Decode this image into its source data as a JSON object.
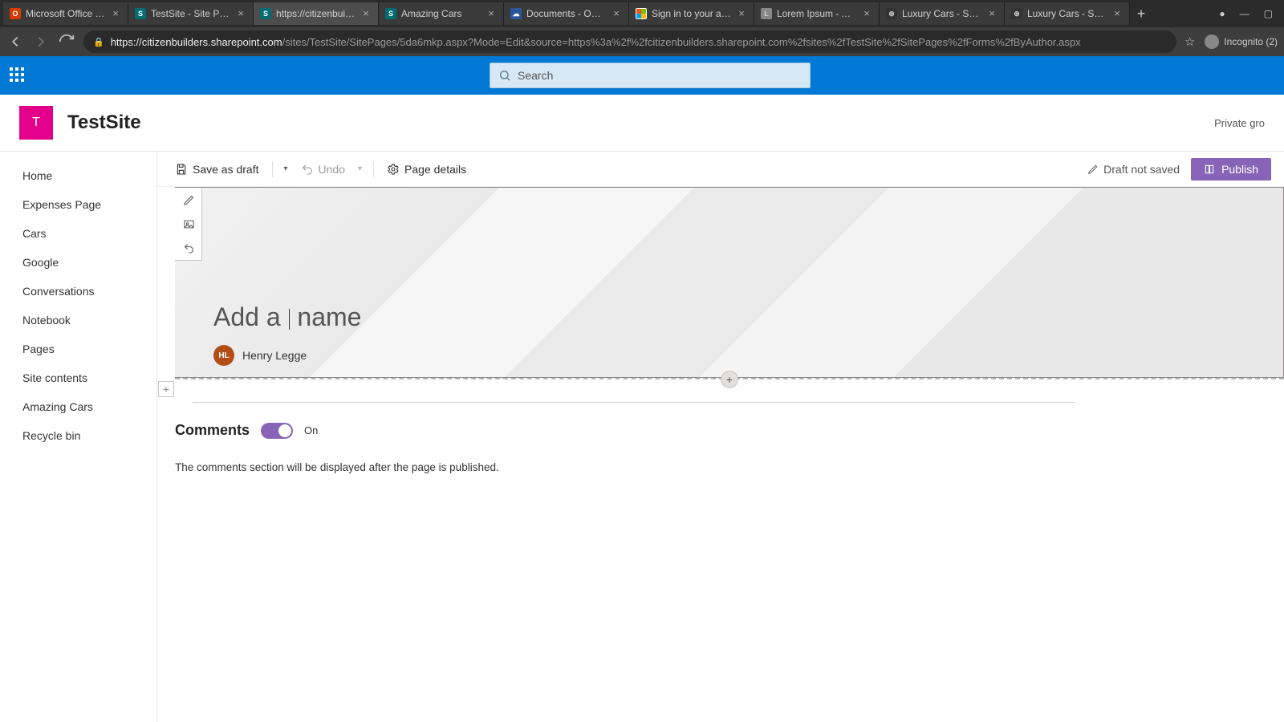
{
  "browser": {
    "tabs": [
      {
        "title": "Microsoft Office Home",
        "favicon": "fav-red",
        "letter": "O"
      },
      {
        "title": "TestSite - Site Pages -",
        "favicon": "fav-teal",
        "letter": "S"
      },
      {
        "title": "https://citizenbuilders",
        "favicon": "fav-teal",
        "letter": "S",
        "active": true
      },
      {
        "title": "Amazing Cars",
        "favicon": "fav-teal",
        "letter": "S"
      },
      {
        "title": "Documents - OneDriv",
        "favicon": "fav-blue",
        "letter": "☁"
      },
      {
        "title": "Sign in to your accoun",
        "favicon": "fav-ms",
        "letter": ""
      },
      {
        "title": "Lorem Ipsum - All the",
        "favicon": "fav-grey",
        "letter": "L"
      },
      {
        "title": "Luxury Cars - Sedans,",
        "favicon": "fav-dark",
        "letter": "⊕"
      },
      {
        "title": "Luxury Cars - Sedans,",
        "favicon": "fav-dark",
        "letter": "⊕"
      }
    ],
    "url_host": "https://citizenbuilders.sharepoint.com",
    "url_path": "/sites/TestSite/SitePages/5da6mkp.aspx?Mode=Edit&source=https%3a%2f%2fcitizenbuilders.sharepoint.com%2fsites%2fTestSite%2fSitePages%2fForms%2fByAuthor.aspx",
    "incognito_label": "Incognito (2)"
  },
  "suite": {
    "search_placeholder": "Search"
  },
  "site": {
    "logo_letter": "T",
    "title": "TestSite",
    "meta": "Private gro"
  },
  "nav": {
    "items": [
      "Home",
      "Expenses Page",
      "Cars",
      "Google",
      "Conversations",
      "Notebook",
      "Pages",
      "Site contents",
      "Amazing Cars",
      "Recycle bin"
    ]
  },
  "cmd": {
    "save": "Save as draft",
    "undo": "Undo",
    "page_details": "Page details",
    "draft_status": "Draft not saved",
    "publish": "Publish"
  },
  "hero": {
    "title_before": "Add a",
    "title_after": "name",
    "author_initials": "HL",
    "author_name": "Henry Legge"
  },
  "comments": {
    "heading": "Comments",
    "toggle_state": "On",
    "note": "The comments section will be displayed after the page is published."
  }
}
